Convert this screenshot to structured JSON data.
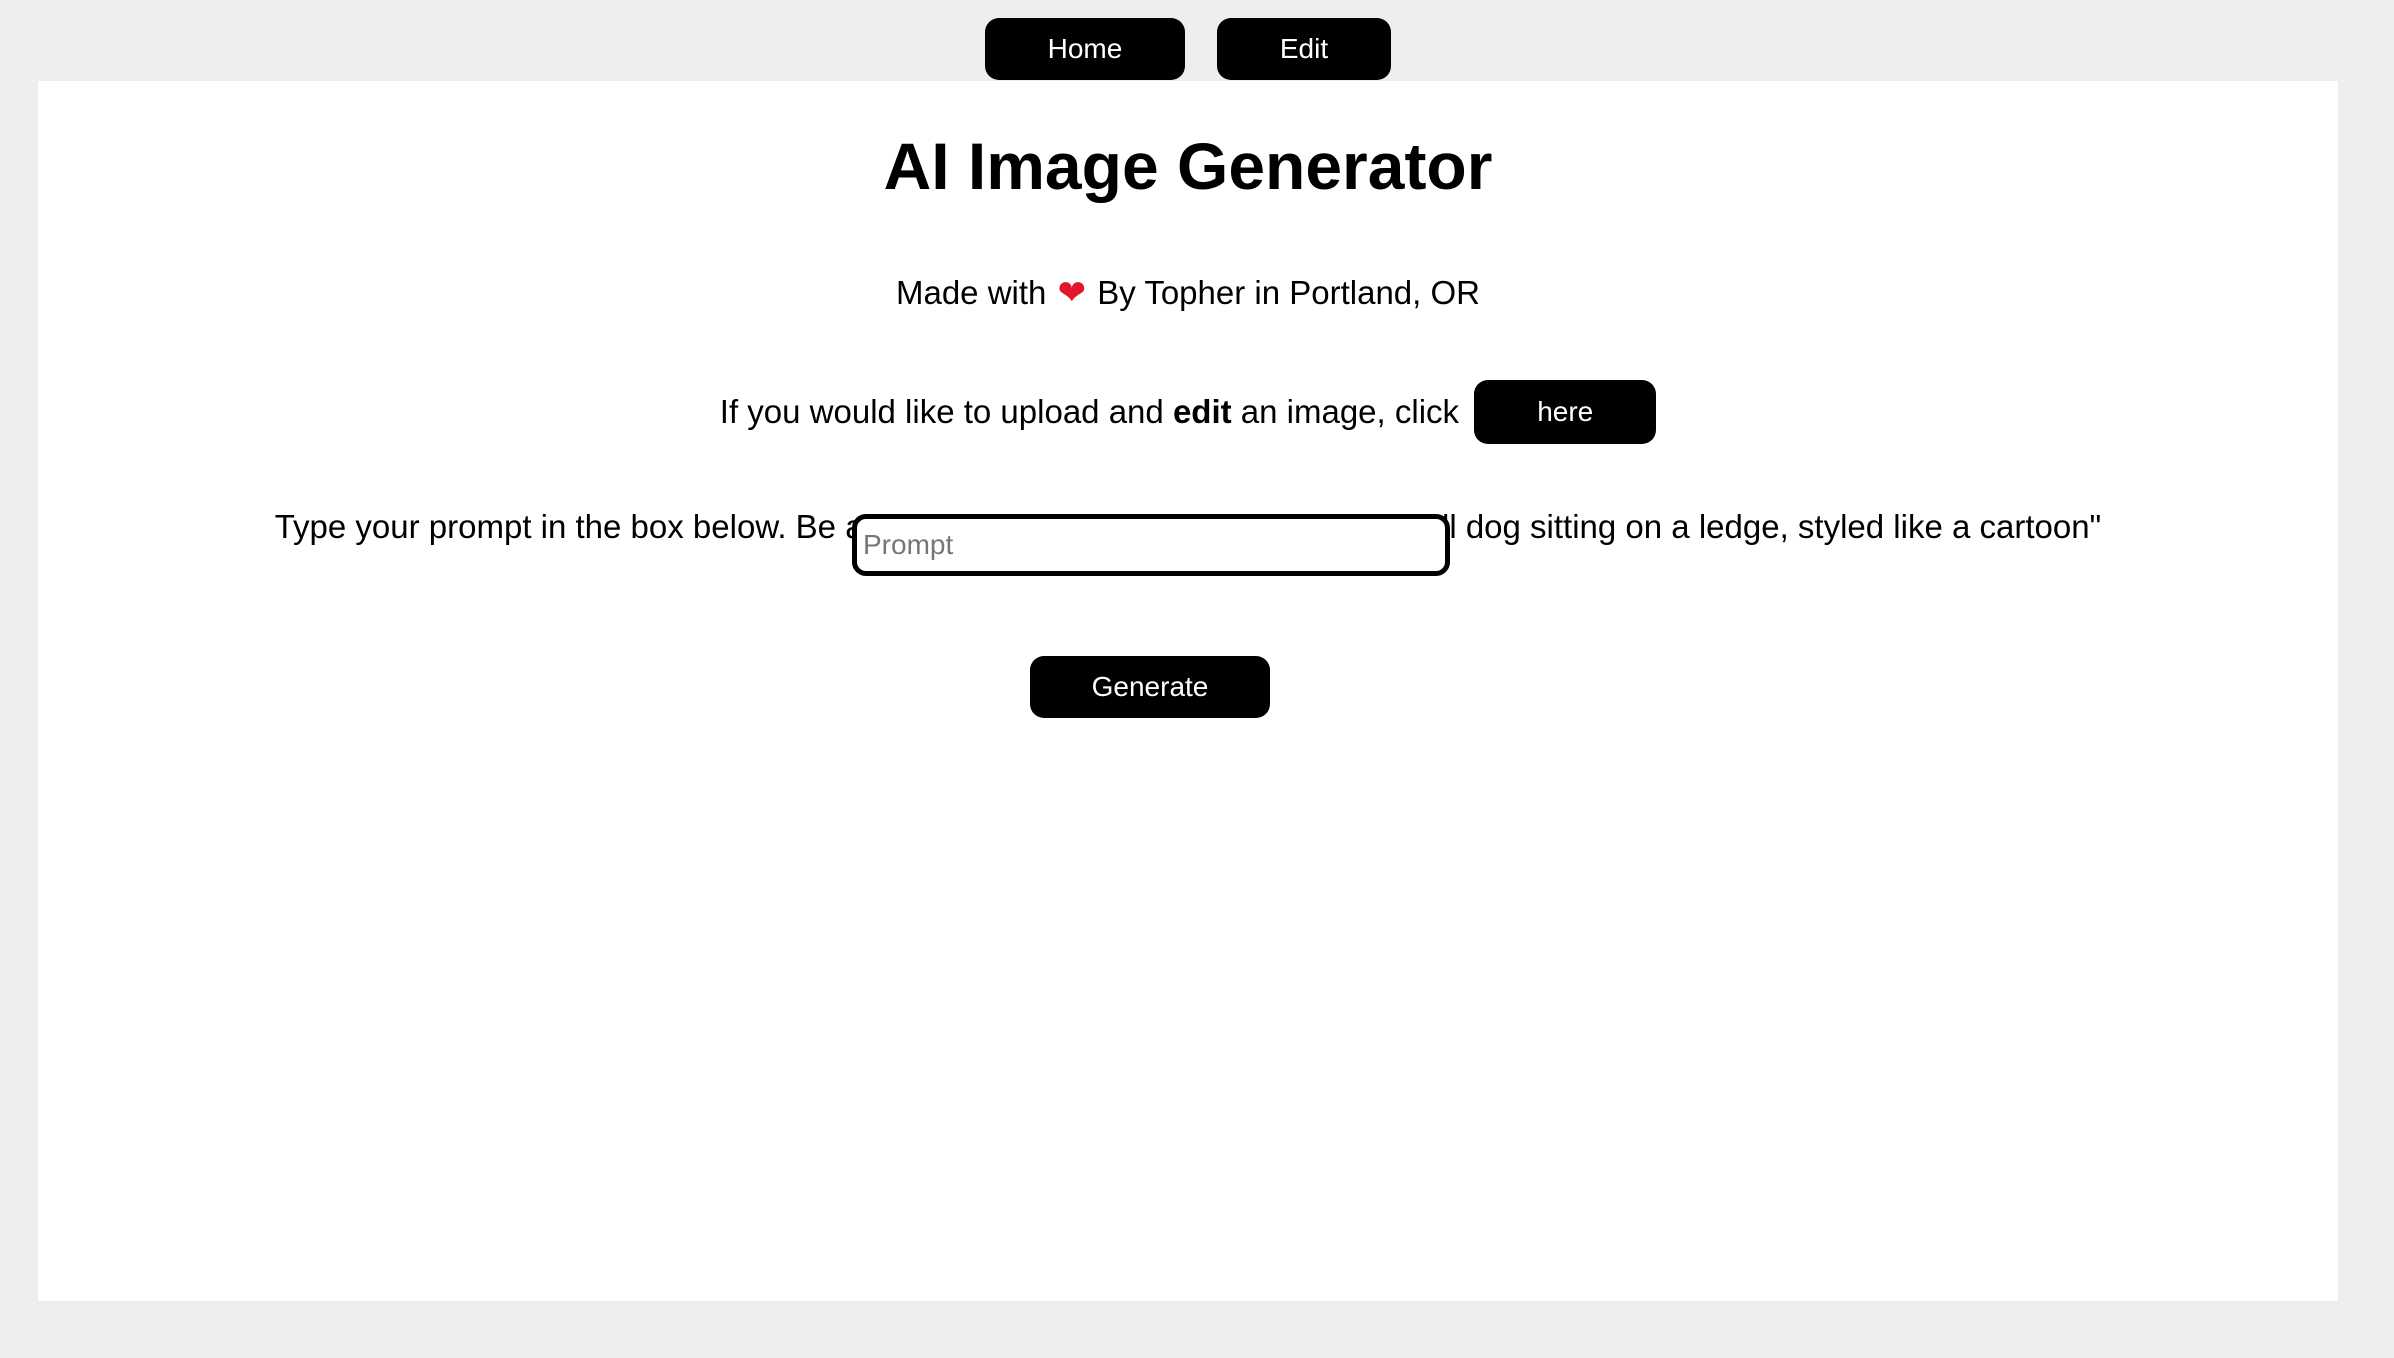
{
  "nav": {
    "home_label": "Home",
    "edit_label": "Edit"
  },
  "main": {
    "title": "AI Image Generator",
    "made_with_prefix": "Made with",
    "heart_icon": "❤",
    "made_with_suffix": "By Topher in Portland, OR",
    "upload_prefix": "If you would like to upload and",
    "upload_bold": "edit",
    "upload_suffix": "an image, click",
    "here_label": "here",
    "instructions": "Type your prompt in the box below. Be as specific as possible. Example: \"A small dog sitting on a ledge, styled like a cartoon\"",
    "prompt_placeholder": "Prompt",
    "prompt_value": "",
    "generate_label": "Generate"
  },
  "colors": {
    "page_background": "#eeeeee",
    "panel_background": "#ffffff",
    "button_background": "#000000",
    "button_text": "#ffffff",
    "heart": "#e0162b"
  }
}
